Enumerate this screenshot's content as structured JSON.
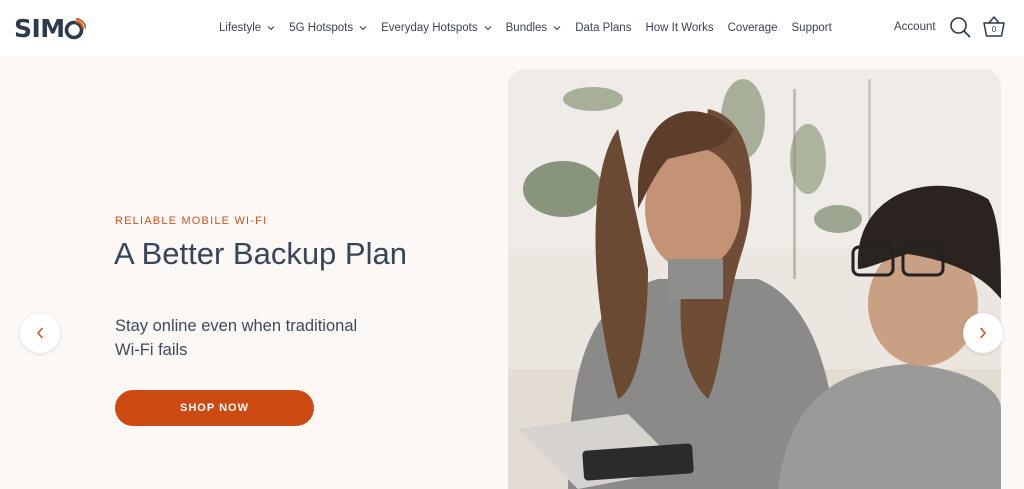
{
  "brand": {
    "logo_text": "SIMO",
    "logo_visible_text": "SIM",
    "accent": "#d2521b",
    "logo_color": "#2b3a4e"
  },
  "nav": {
    "items": [
      {
        "label": "Lifestyle",
        "has_dropdown": true
      },
      {
        "label": "5G Hotspots",
        "has_dropdown": true
      },
      {
        "label": "Everyday Hotspots",
        "has_dropdown": true
      },
      {
        "label": "Bundles",
        "has_dropdown": true
      },
      {
        "label": "Data Plans",
        "has_dropdown": false
      },
      {
        "label": "How It Works",
        "has_dropdown": false
      },
      {
        "label": "Coverage",
        "has_dropdown": false
      },
      {
        "label": "Support",
        "has_dropdown": false
      }
    ]
  },
  "header": {
    "account_label": "Account",
    "search_icon": "search-icon",
    "cart_icon": "basket-icon",
    "cart_count": "0"
  },
  "hero": {
    "eyebrow": "RELIABLE MOBILE WI-FI",
    "title": "A Better Backup Plan",
    "subtitle": "Stay online even when traditional Wi-Fi fails",
    "cta_label": "SHOP NOW",
    "cta_color": "#cc4a12",
    "prev_icon": "chevron-left-icon",
    "next_icon": "chevron-right-icon"
  }
}
